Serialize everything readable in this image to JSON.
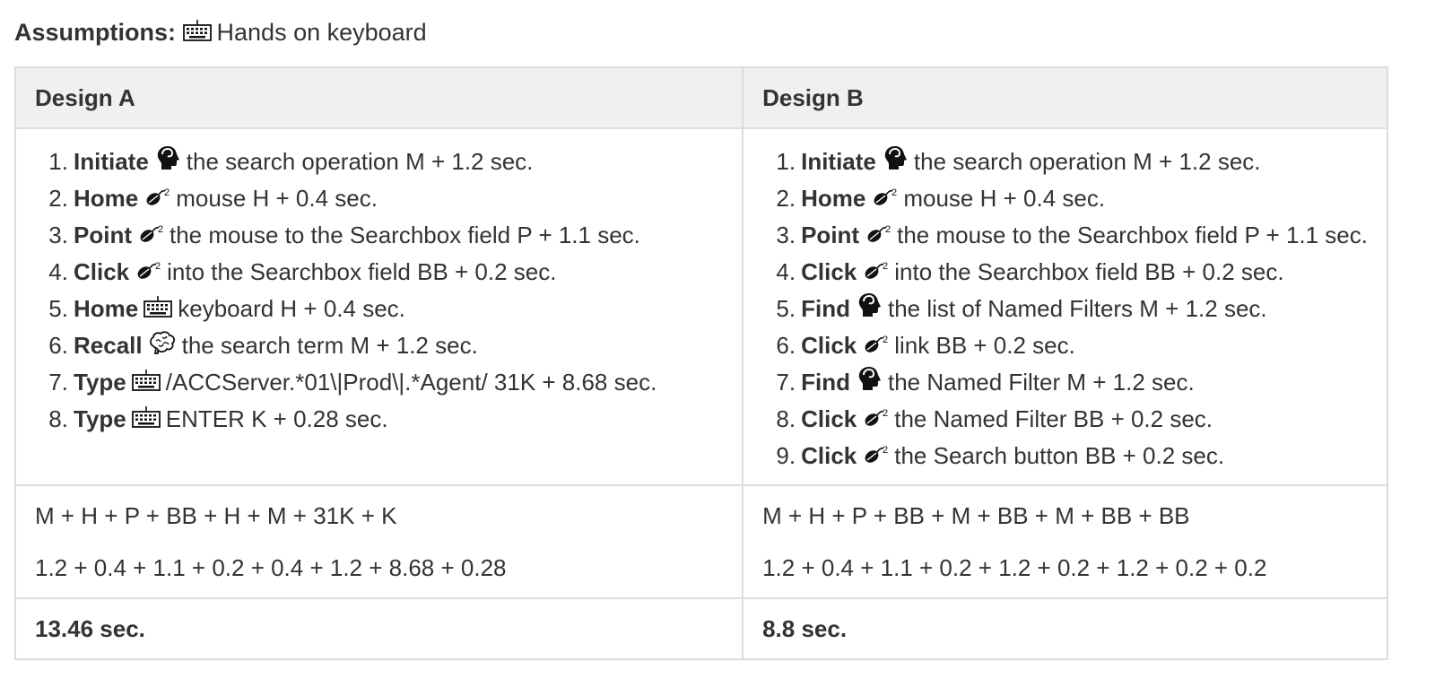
{
  "assumptions": {
    "label": "Assumptions:",
    "icon": "keyboard-icon",
    "text": "Hands on keyboard"
  },
  "designs": [
    {
      "header": "Design A",
      "steps": [
        {
          "operator": "Initiate",
          "icon": "head-icon",
          "text": "the search operation M + 1.2 sec."
        },
        {
          "operator": "Home",
          "icon": "mouse-icon",
          "text": "mouse H + 0.4 sec."
        },
        {
          "operator": "Point",
          "icon": "mouse-icon",
          "text": "the mouse to the Searchbox field P + 1.1 sec."
        },
        {
          "operator": "Click",
          "icon": "mouse-icon",
          "text": "into the Searchbox field BB + 0.2 sec."
        },
        {
          "operator": "Home",
          "icon": "keyboard-icon",
          "text": "keyboard H + 0.4 sec."
        },
        {
          "operator": "Recall",
          "icon": "brain-icon",
          "text": "the search term M + 1.2 sec."
        },
        {
          "operator": "Type",
          "icon": "keyboard-icon",
          "text": "/ACCServer.*01\\|Prod\\|.*Agent/ 31K + 8.68 sec."
        },
        {
          "operator": "Type",
          "icon": "keyboard-icon",
          "text": "ENTER K + 0.28 sec."
        }
      ],
      "formula": "M + H + P + BB + H + M + 31K + K",
      "sum": "1.2 + 0.4 + 1.1 + 0.2 + 0.4 + 1.2 + 8.68 + 0.28",
      "total": "13.46 sec."
    },
    {
      "header": "Design B",
      "steps": [
        {
          "operator": "Initiate",
          "icon": "head-icon",
          "text": "the search operation M + 1.2 sec."
        },
        {
          "operator": "Home",
          "icon": "mouse-icon",
          "text": "mouse H + 0.4 sec."
        },
        {
          "operator": "Point",
          "icon": "mouse-icon",
          "text": "the mouse to the Searchbox field P + 1.1 sec."
        },
        {
          "operator": "Click",
          "icon": "mouse-icon",
          "text": "into the Searchbox field BB + 0.2 sec."
        },
        {
          "operator": "Find",
          "icon": "head-icon",
          "text": "the list of Named Filters M + 1.2 sec."
        },
        {
          "operator": "Click",
          "icon": "mouse-icon",
          "text": "link BB + 0.2 sec."
        },
        {
          "operator": "Find",
          "icon": "head-icon",
          "text": "the Named Filter M + 1.2 sec."
        },
        {
          "operator": "Click",
          "icon": "mouse-icon",
          "text": "the Named Filter BB + 0.2 sec."
        },
        {
          "operator": "Click",
          "icon": "mouse-icon",
          "text": "the Search button BB + 0.2 sec."
        }
      ],
      "formula": "M + H + P + BB + M + BB + M + BB + BB",
      "sum": "1.2 + 0.4 + 1.1 + 0.2 + 1.2 + 0.2 + 1.2 + 0.2 + 0.2",
      "total": "8.8 sec."
    }
  ]
}
